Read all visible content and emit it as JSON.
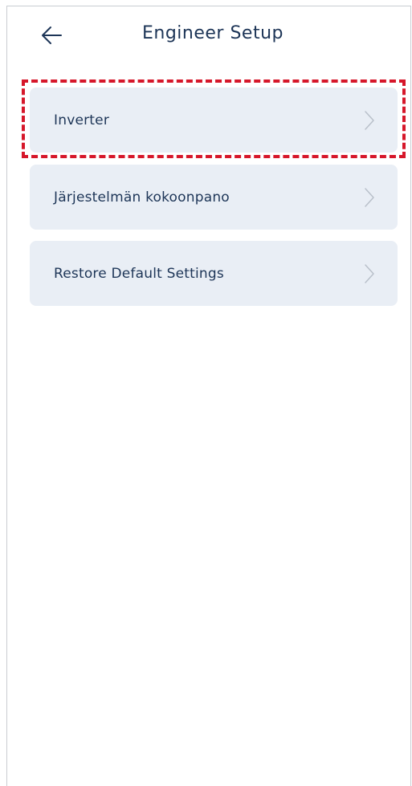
{
  "header": {
    "title": "Engineer Setup",
    "back_icon": "arrow-left-icon"
  },
  "menu": {
    "items": [
      {
        "label": "Inverter",
        "icon": "chevron-right-icon"
      },
      {
        "label": "Järjestelmän kokoonpano",
        "icon": "chevron-right-icon"
      },
      {
        "label": "Restore Default Settings",
        "icon": "chevron-right-icon"
      }
    ],
    "highlighted_index": 0
  },
  "colors": {
    "text": "#1d3557",
    "item_bg": "#e9eef5",
    "chevron": "#b9c0ca",
    "highlight": "#d6172a"
  }
}
